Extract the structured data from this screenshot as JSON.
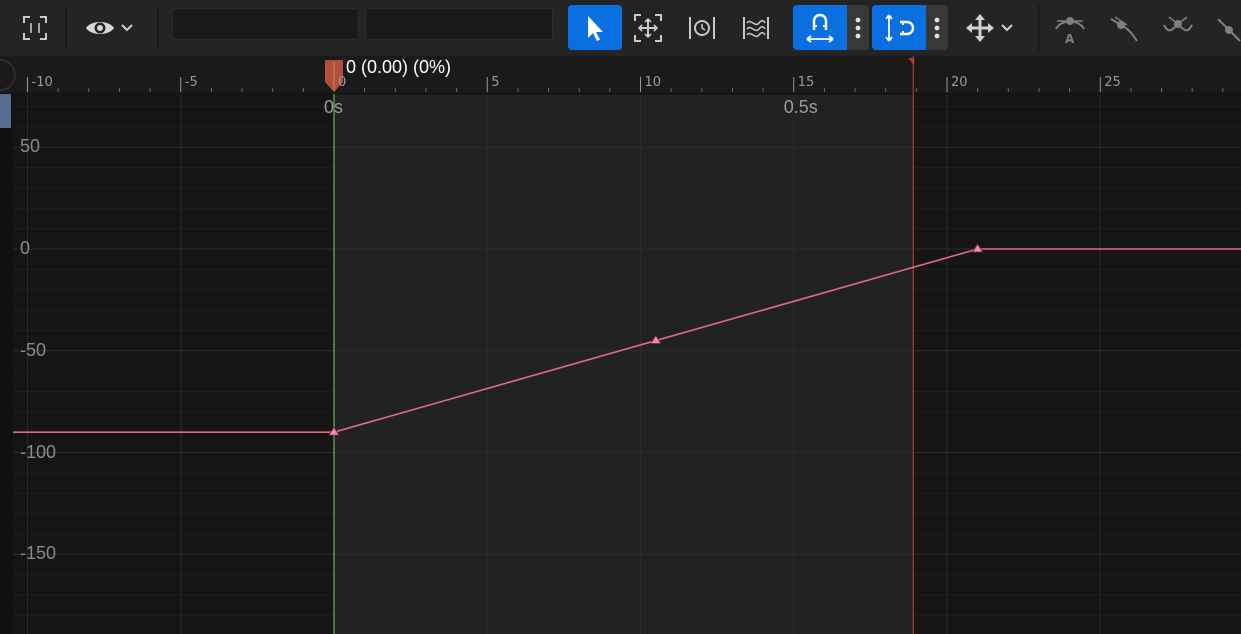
{
  "toolbar": {
    "frame_icon": "frame-selection-icon",
    "view_icon": "eye-icon",
    "tools": [
      {
        "id": "select",
        "icon": "cursor-arrow-icon",
        "active": true
      },
      {
        "id": "transform",
        "icon": "transform-box-icon",
        "active": false
      },
      {
        "id": "retime",
        "icon": "retime-clock-icon",
        "active": false
      },
      {
        "id": "multiselect-curves",
        "icon": "stacked-curves-icon",
        "active": false
      }
    ],
    "snap_time": {
      "icon": "snap-horizontal-magnet-icon",
      "active": true
    },
    "snap_value": {
      "icon": "snap-vertical-magnet-icon",
      "active": true
    },
    "axis_mode_icon": "move-arrows-icon",
    "tangent_tools": [
      "auto-tangent-icon",
      "user-tangent-icon",
      "break-tangent-icon",
      "linear-tangent-icon"
    ]
  },
  "timeline": {
    "frame_labels": [
      {
        "value": -10,
        "text": "-10"
      },
      {
        "value": -5,
        "text": "-5"
      },
      {
        "value": 0,
        "text": "0"
      },
      {
        "value": 5,
        "text": "5"
      },
      {
        "value": 10,
        "text": "10"
      },
      {
        "value": 15,
        "text": "15"
      },
      {
        "value": 20,
        "text": "20"
      },
      {
        "value": 25,
        "text": "25"
      }
    ],
    "time_labels": [
      {
        "frame": 0,
        "text": "0s"
      },
      {
        "frame": 15,
        "text": "0.5s"
      }
    ],
    "playhead": {
      "frame": 0,
      "readout": "0 (0.00) (0%)"
    },
    "end_marker_frame": 18.9
  },
  "value_axis": {
    "labels": [
      {
        "value": 50,
        "text": "50"
      },
      {
        "value": 0,
        "text": "0"
      },
      {
        "value": -50,
        "text": "-50"
      },
      {
        "value": -100,
        "text": "-100"
      },
      {
        "value": -150,
        "text": "-150"
      }
    ]
  },
  "curve": {
    "color": "#e06a8c",
    "key_color": "#f087b8",
    "keys": [
      {
        "frame": 0,
        "value": -90
      },
      {
        "frame": 10.5,
        "value": -45
      },
      {
        "frame": 21,
        "value": 0
      }
    ]
  },
  "colors": {
    "accent": "#0a70e0",
    "playhead_line": "#5fb84f",
    "playhead_flag": "#b0503a",
    "end_marker": "#a03c3c",
    "background": "#151515",
    "active_range": "#222222"
  }
}
